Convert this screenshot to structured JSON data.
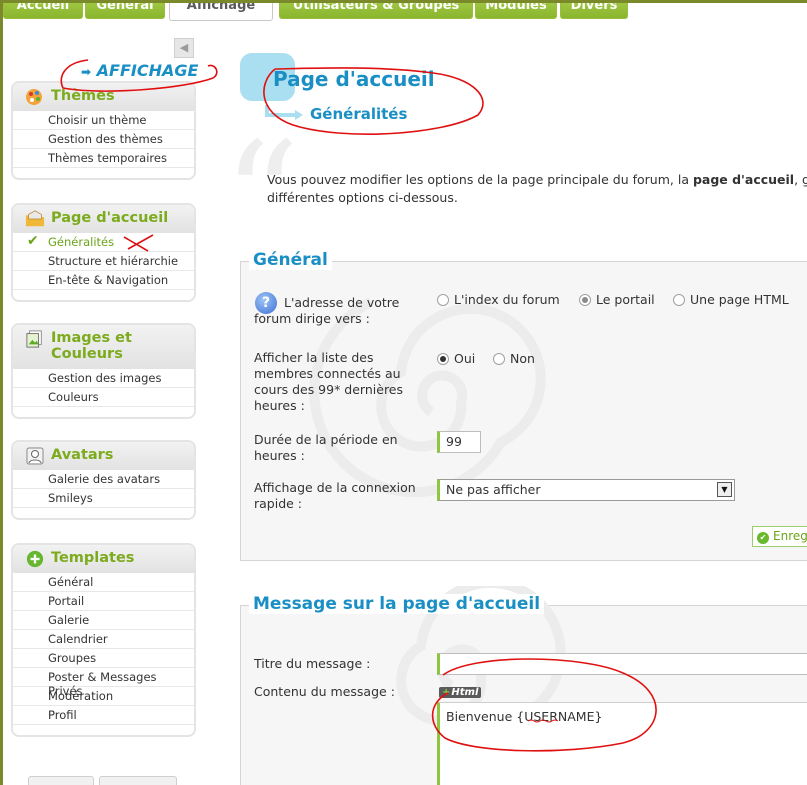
{
  "tabs": [
    "Accueil",
    "Général",
    "Affichage",
    "Utilisateurs & Groupes",
    "Modules",
    "Divers"
  ],
  "active_tab_index": 2,
  "sidebar": {
    "title": "AFFICHAGE",
    "title_prefix": "➡",
    "collapse_icon": "◀",
    "sections": [
      {
        "title": "Thèmes",
        "icon": "palette-icon",
        "items": [
          "Choisir un thème",
          "Gestion des thèmes",
          "Thèmes temporaires"
        ]
      },
      {
        "title": "Page d'accueil",
        "icon": "folder-home-icon",
        "items": [
          "Généralités",
          "Structure et hiérarchie",
          "En-tête & Navigation"
        ],
        "active_item": 0
      },
      {
        "title": "Images et Couleurs",
        "icon": "images-icon",
        "items": [
          "Gestion des images",
          "Couleurs"
        ]
      },
      {
        "title": "Avatars",
        "icon": "avatar-icon",
        "items": [
          "Galerie des avatars",
          "Smileys"
        ]
      },
      {
        "title": "Templates",
        "icon": "plus-circle-icon",
        "items": [
          "Général",
          "Portail",
          "Galerie",
          "Calendrier",
          "Groupes",
          "Poster & Messages Privés",
          "Modération",
          "Profil"
        ]
      }
    ]
  },
  "main": {
    "title": "Page d'accueil",
    "subtitle": "Généralités",
    "intro_before": "Vous pouvez modifier les options de la page principale du forum, la ",
    "intro_bold": "page d'accueil",
    "intro_after": ", gr",
    "intro_line2": "différentes options ci-dessous.",
    "general": {
      "legend": "Général",
      "forum_address_label": "L'adresse de votre forum dirige vers :",
      "forum_address_options": [
        "L'index du forum",
        "Le portail",
        "Une page HTML"
      ],
      "forum_address_selected": "Le portail",
      "show_connected_label": "Afficher la liste des membres connectés au cours des 99* dernières heures :",
      "show_connected_options": [
        "Oui",
        "Non"
      ],
      "show_connected_selected": "Oui",
      "duration_label": "Durée de la période en heures :",
      "duration_value": "99",
      "quick_login_label": "Affichage de la connexion rapide :",
      "quick_login_value": "Ne pas afficher",
      "save_label": "Enreg"
    },
    "message": {
      "legend": "Message sur la page d'accueil",
      "title_label": "Titre du message :",
      "title_value": "",
      "content_label": "Contenu du message :",
      "html_badge": "Html",
      "content_value": "Bienvenue {USERNAME}"
    }
  },
  "colors": {
    "accent_blue": "#1a8fc4",
    "accent_green": "#7cab1d",
    "annotation_red": "#e01010"
  }
}
